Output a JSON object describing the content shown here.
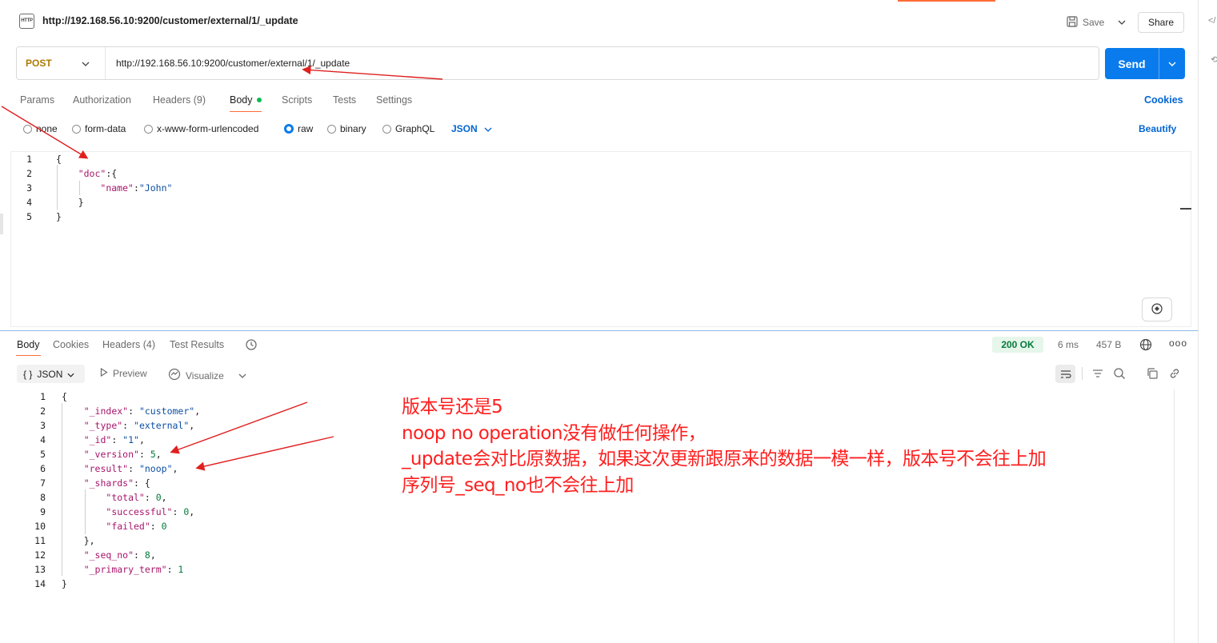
{
  "header": {
    "http_icon_text": "HTTP",
    "title": "http://192.168.56.10:9200/customer/external/1/_update",
    "save_label": "Save",
    "share_label": "Share"
  },
  "request": {
    "method": "POST",
    "url": "http://192.168.56.10:9200/customer/external/1/_update",
    "send_label": "Send",
    "tabs": [
      {
        "label": "Params"
      },
      {
        "label": "Authorization"
      },
      {
        "label": "Headers (9)"
      },
      {
        "label": "Body"
      },
      {
        "label": "Scripts"
      },
      {
        "label": "Tests"
      },
      {
        "label": "Settings"
      }
    ],
    "active_tab": "Body",
    "cookies_label": "Cookies",
    "body_types": [
      {
        "label": "none",
        "selected": false
      },
      {
        "label": "form-data",
        "selected": false
      },
      {
        "label": "x-www-form-urlencoded",
        "selected": false
      },
      {
        "label": "raw",
        "selected": true
      },
      {
        "label": "binary",
        "selected": false
      },
      {
        "label": "GraphQL",
        "selected": false
      }
    ],
    "format": "JSON",
    "beautify_label": "Beautify",
    "editor": {
      "line_numbers": [
        "1",
        "2",
        "3",
        "4",
        "5"
      ]
    }
  },
  "response": {
    "tabs": [
      {
        "label": "Body"
      },
      {
        "label": "Cookies"
      },
      {
        "label": "Headers (4)"
      },
      {
        "label": "Test Results"
      }
    ],
    "active_tab": "Body",
    "status": "200 OK",
    "time": "6 ms",
    "size": "457 B",
    "more_label": "ooo",
    "format_label": "JSON",
    "format_icon": "{ }",
    "preview_label": "Preview",
    "visualize_label": "Visualize",
    "editor": {
      "line_numbers": [
        "1",
        "2",
        "3",
        "4",
        "5",
        "6",
        "7",
        "8",
        "9",
        "10",
        "11",
        "12",
        "13",
        "14"
      ]
    }
  },
  "annotation": {
    "lines": [
      "版本号还是5",
      "noop no operation没有做任何操作，",
      "_update会对比原数据，如果这次更新跟原来的数据一模一样，版本号不会往上加",
      "序列号_seq_no也不会往上加"
    ],
    "color": "#ff1f1f"
  },
  "colors": {
    "accent": "#ff6c37",
    "send": "#097bed",
    "link": "#0265d2",
    "method": "#ad7a03",
    "status_ok": "#067a3a"
  }
}
